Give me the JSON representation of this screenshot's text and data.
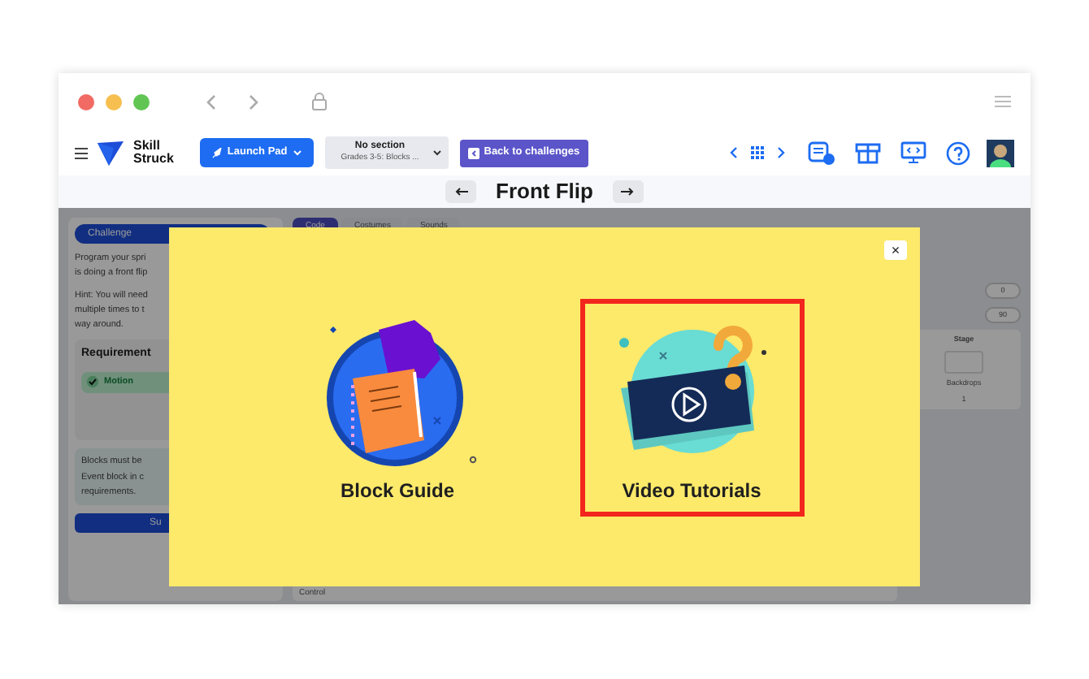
{
  "toolbar": {
    "brand": [
      "Skill",
      "Struck"
    ],
    "launch_button": "Launch Pad",
    "section": {
      "value": "No section",
      "subtitle": "Grades 3-5: Blocks ..."
    },
    "back_button": "Back to challenges"
  },
  "title": "Front Flip",
  "background": {
    "tabs": [
      {
        "label": "Challenge",
        "selected": true
      },
      {
        "label": "Code",
        "selected": true
      },
      {
        "label": "Costumes",
        "selected": false
      },
      {
        "label": "Sounds",
        "selected": false
      }
    ],
    "instructions": [
      "Program your spri",
      "is doing a front flip"
    ],
    "hint": [
      "Hint: You will need",
      "multiple times to t",
      "way around."
    ],
    "requirements_title": "Requirement",
    "requirement": {
      "label": "Motion",
      "checked": true
    },
    "note": [
      "Blocks must be",
      "Event block in c",
      "requirements."
    ],
    "submit": "Su",
    "category": "Control",
    "stage_label": "Stage",
    "backdrops_label": "Backdrops",
    "backdrops_count": "1",
    "field_values": [
      "0",
      "90"
    ]
  },
  "modal": {
    "close": "×",
    "cards": [
      {
        "kind": "guide",
        "label": "Block Guide",
        "highlighted": false
      },
      {
        "kind": "video",
        "label": "Video Tutorials",
        "highlighted": true
      }
    ]
  }
}
